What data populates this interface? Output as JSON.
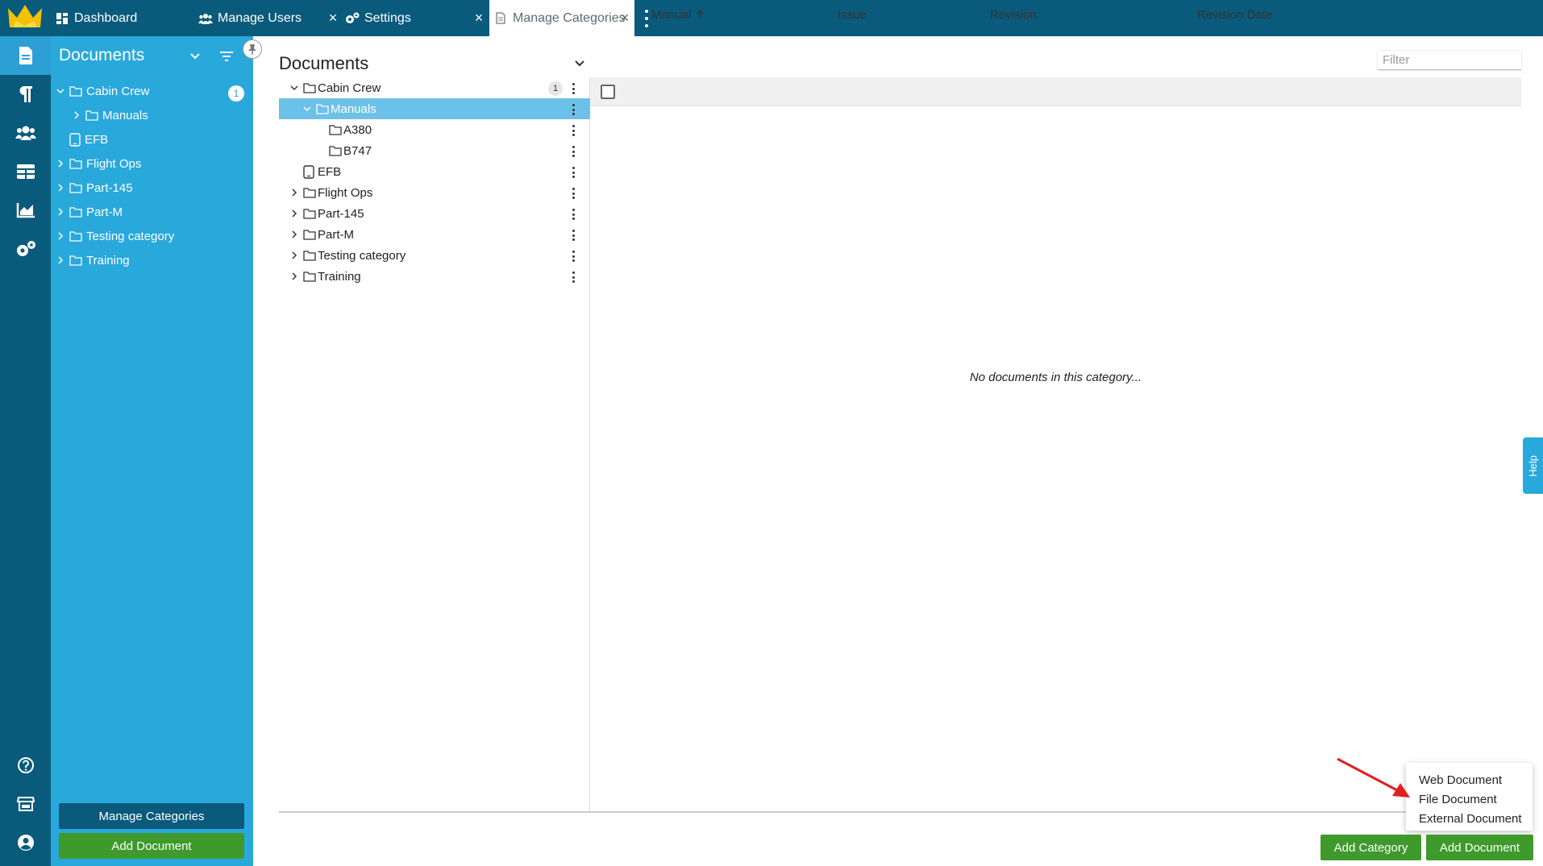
{
  "tabs": [
    {
      "label": "Dashboard",
      "icon": "dashboard-icon"
    },
    {
      "label": "Manage Users",
      "icon": "users-icon"
    },
    {
      "label": "Settings",
      "icon": "gears-icon"
    },
    {
      "label": "Manage Categories",
      "icon": "document-icon",
      "active": true
    }
  ],
  "rail": [
    "documents-icon",
    "paragraph-icon",
    "users-icon",
    "table-icon",
    "chart-icon",
    "gears-icon",
    "help-icon",
    "store-icon",
    "user-circle-icon"
  ],
  "left_panel": {
    "title": "Documents",
    "tree": [
      {
        "label": "Cabin Crew",
        "expanded": true,
        "badge": "1"
      },
      {
        "label": "Manuals",
        "expanded": false
      },
      {
        "label": "EFB"
      },
      {
        "label": "Flight Ops"
      },
      {
        "label": "Part-145"
      },
      {
        "label": "Part-M"
      },
      {
        "label": "Testing category"
      },
      {
        "label": "Training"
      }
    ],
    "manage_button": "Manage Categories",
    "add_button": "Add Document"
  },
  "main": {
    "title": "Documents",
    "filter_placeholder": "Filter",
    "tree": [
      {
        "label": "Cabin Crew",
        "badge": "1"
      },
      {
        "label": "Manuals",
        "selected": true
      },
      {
        "label": "A380"
      },
      {
        "label": "B747"
      },
      {
        "label": "EFB"
      },
      {
        "label": "Flight Ops"
      },
      {
        "label": "Part-145"
      },
      {
        "label": "Part-M"
      },
      {
        "label": "Testing category"
      },
      {
        "label": "Training"
      }
    ],
    "columns": [
      "Manual",
      "Issue",
      "Revision",
      "Revision Date"
    ],
    "empty_message": "No documents in this category...",
    "help_label": "Help"
  },
  "add_document_menu": [
    "Web Document",
    "File Document",
    "External Document"
  ],
  "footer": {
    "add_category": "Add Category",
    "add_document": "Add Document"
  },
  "colors": {
    "topbar": "#0a5a7c",
    "left_panel": "#29a8dc",
    "selected_row": "#6cc1e8",
    "green_button": "#3f9a2c",
    "arrow": "#e02020"
  }
}
